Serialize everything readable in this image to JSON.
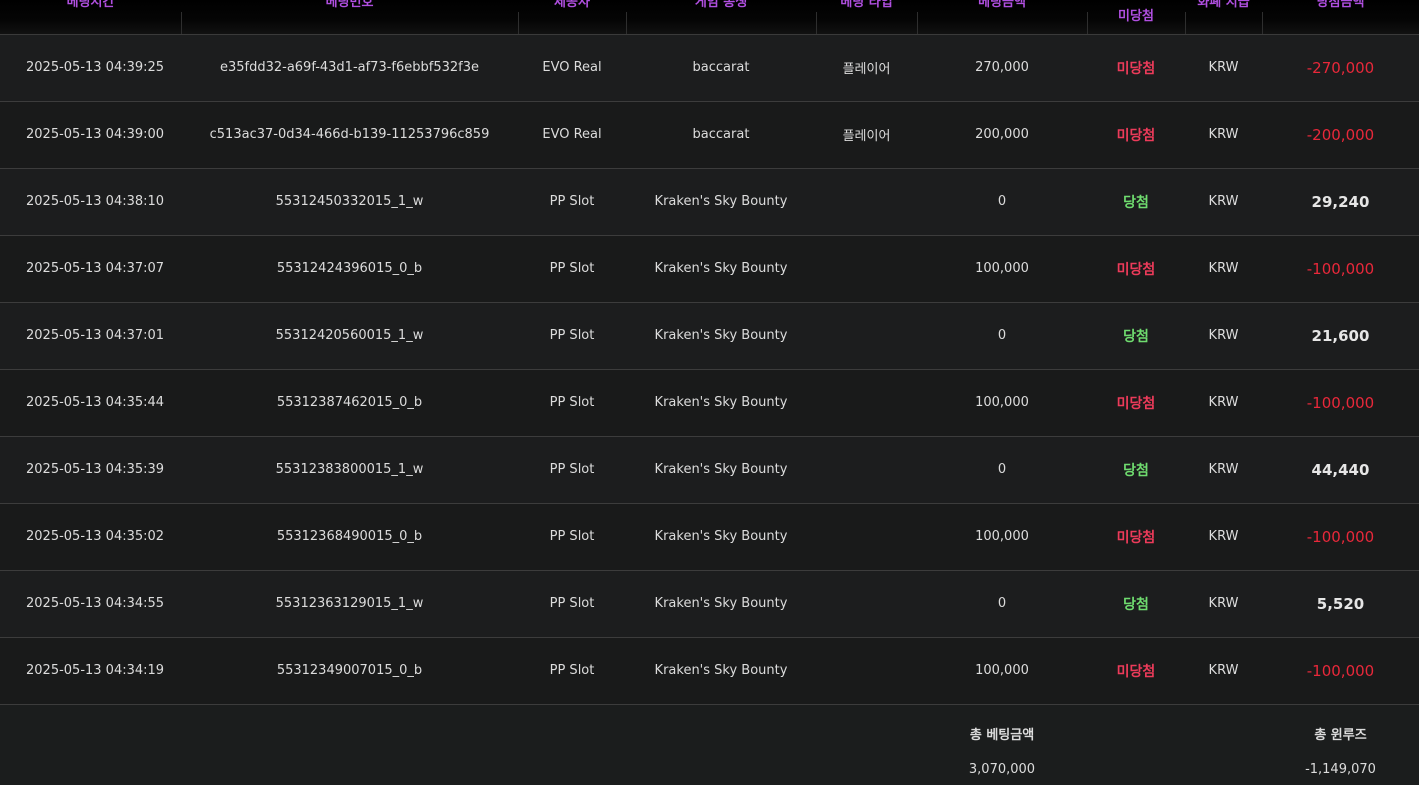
{
  "columns": {
    "time": "베팅시간",
    "bet_id": "베팅번호",
    "provider": "제공사",
    "game": "게임 종생",
    "bet_type": "베팅 타입",
    "bet_amount": "베팅금액",
    "result": "미당첨",
    "currency": "화폐 지급",
    "win_amount": "당첨금액"
  },
  "rows": [
    {
      "time": "2025-05-13 04:39:25",
      "bet_id": "e35fdd32-a69f-43d1-af73-f6ebbf532f3e",
      "provider": "EVO Real",
      "game": "baccarat",
      "bet_type": "플레이어",
      "bet_amount": "270,000",
      "result": "미당첨",
      "currency": "KRW",
      "win_amount": "-270,000"
    },
    {
      "time": "2025-05-13 04:39:00",
      "bet_id": "c513ac37-0d34-466d-b139-11253796c859",
      "provider": "EVO Real",
      "game": "baccarat",
      "bet_type": "플레이어",
      "bet_amount": "200,000",
      "result": "미당첨",
      "currency": "KRW",
      "win_amount": "-200,000"
    },
    {
      "time": "2025-05-13 04:38:10",
      "bet_id": "55312450332015_1_w",
      "provider": "PP Slot",
      "game": "Kraken's Sky Bounty",
      "bet_type": "",
      "bet_amount": "0",
      "result": "당첨",
      "currency": "KRW",
      "win_amount": "29,240"
    },
    {
      "time": "2025-05-13 04:37:07",
      "bet_id": "55312424396015_0_b",
      "provider": "PP Slot",
      "game": "Kraken's Sky Bounty",
      "bet_type": "",
      "bet_amount": "100,000",
      "result": "미당첨",
      "currency": "KRW",
      "win_amount": "-100,000"
    },
    {
      "time": "2025-05-13 04:37:01",
      "bet_id": "55312420560015_1_w",
      "provider": "PP Slot",
      "game": "Kraken's Sky Bounty",
      "bet_type": "",
      "bet_amount": "0",
      "result": "당첨",
      "currency": "KRW",
      "win_amount": "21,600"
    },
    {
      "time": "2025-05-13 04:35:44",
      "bet_id": "55312387462015_0_b",
      "provider": "PP Slot",
      "game": "Kraken's Sky Bounty",
      "bet_type": "",
      "bet_amount": "100,000",
      "result": "미당첨",
      "currency": "KRW",
      "win_amount": "-100,000"
    },
    {
      "time": "2025-05-13 04:35:39",
      "bet_id": "55312383800015_1_w",
      "provider": "PP Slot",
      "game": "Kraken's Sky Bounty",
      "bet_type": "",
      "bet_amount": "0",
      "result": "당첨",
      "currency": "KRW",
      "win_amount": "44,440"
    },
    {
      "time": "2025-05-13 04:35:02",
      "bet_id": "55312368490015_0_b",
      "provider": "PP Slot",
      "game": "Kraken's Sky Bounty",
      "bet_type": "",
      "bet_amount": "100,000",
      "result": "미당첨",
      "currency": "KRW",
      "win_amount": "-100,000"
    },
    {
      "time": "2025-05-13 04:34:55",
      "bet_id": "55312363129015_1_w",
      "provider": "PP Slot",
      "game": "Kraken's Sky Bounty",
      "bet_type": "",
      "bet_amount": "0",
      "result": "당첨",
      "currency": "KRW",
      "win_amount": "5,520"
    },
    {
      "time": "2025-05-13 04:34:19",
      "bet_id": "55312349007015_0_b",
      "provider": "PP Slot",
      "game": "Kraken's Sky Bounty",
      "bet_type": "",
      "bet_amount": "100,000",
      "result": "미당첨",
      "currency": "KRW",
      "win_amount": "-100,000"
    }
  ],
  "summary": {
    "total_bet_label": "총 베팅금액",
    "total_bet_value": "3,070,000",
    "total_winloss_label": "총 윈루즈",
    "total_winloss_value": "-1,149,070"
  },
  "colors": {
    "header_text": "#b04fe0",
    "lose": "#ec3b5a",
    "win": "#6fdc6f",
    "negative_amount": "#e8283a"
  }
}
